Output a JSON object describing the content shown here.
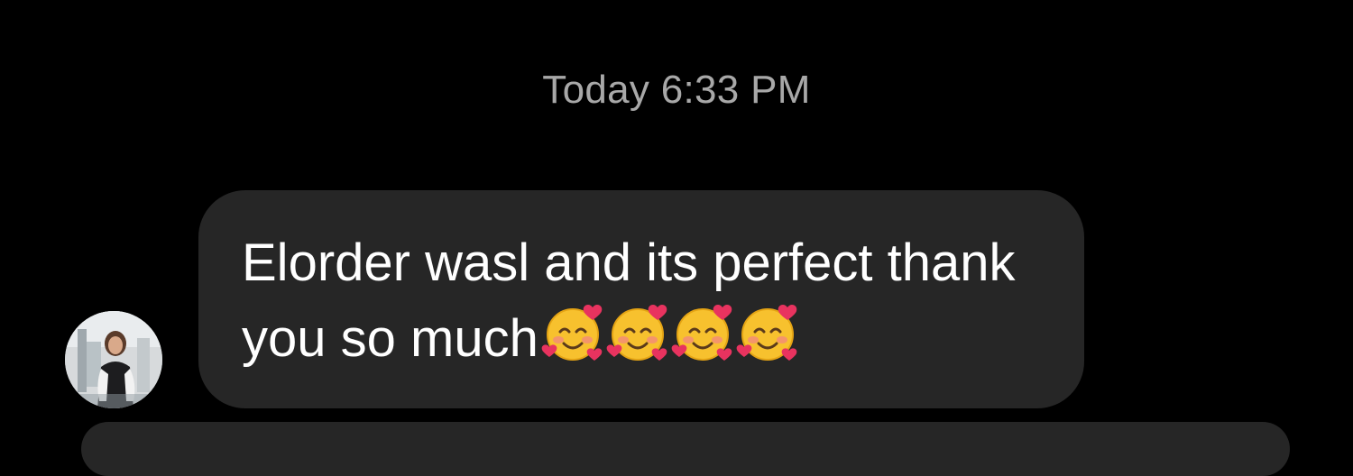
{
  "timestamp": "Today 6:33 PM",
  "message": {
    "sender_avatar": "user-avatar-photo",
    "text": "Elorder wasl and its perfect thank you so much",
    "emojis": [
      "smiling-face-with-hearts",
      "smiling-face-with-hearts",
      "smiling-face-with-hearts",
      "smiling-face-with-hearts"
    ]
  },
  "colors": {
    "background": "#000000",
    "bubble": "#262626",
    "timestamp": "#a8a8a8",
    "text": "#ffffff"
  }
}
